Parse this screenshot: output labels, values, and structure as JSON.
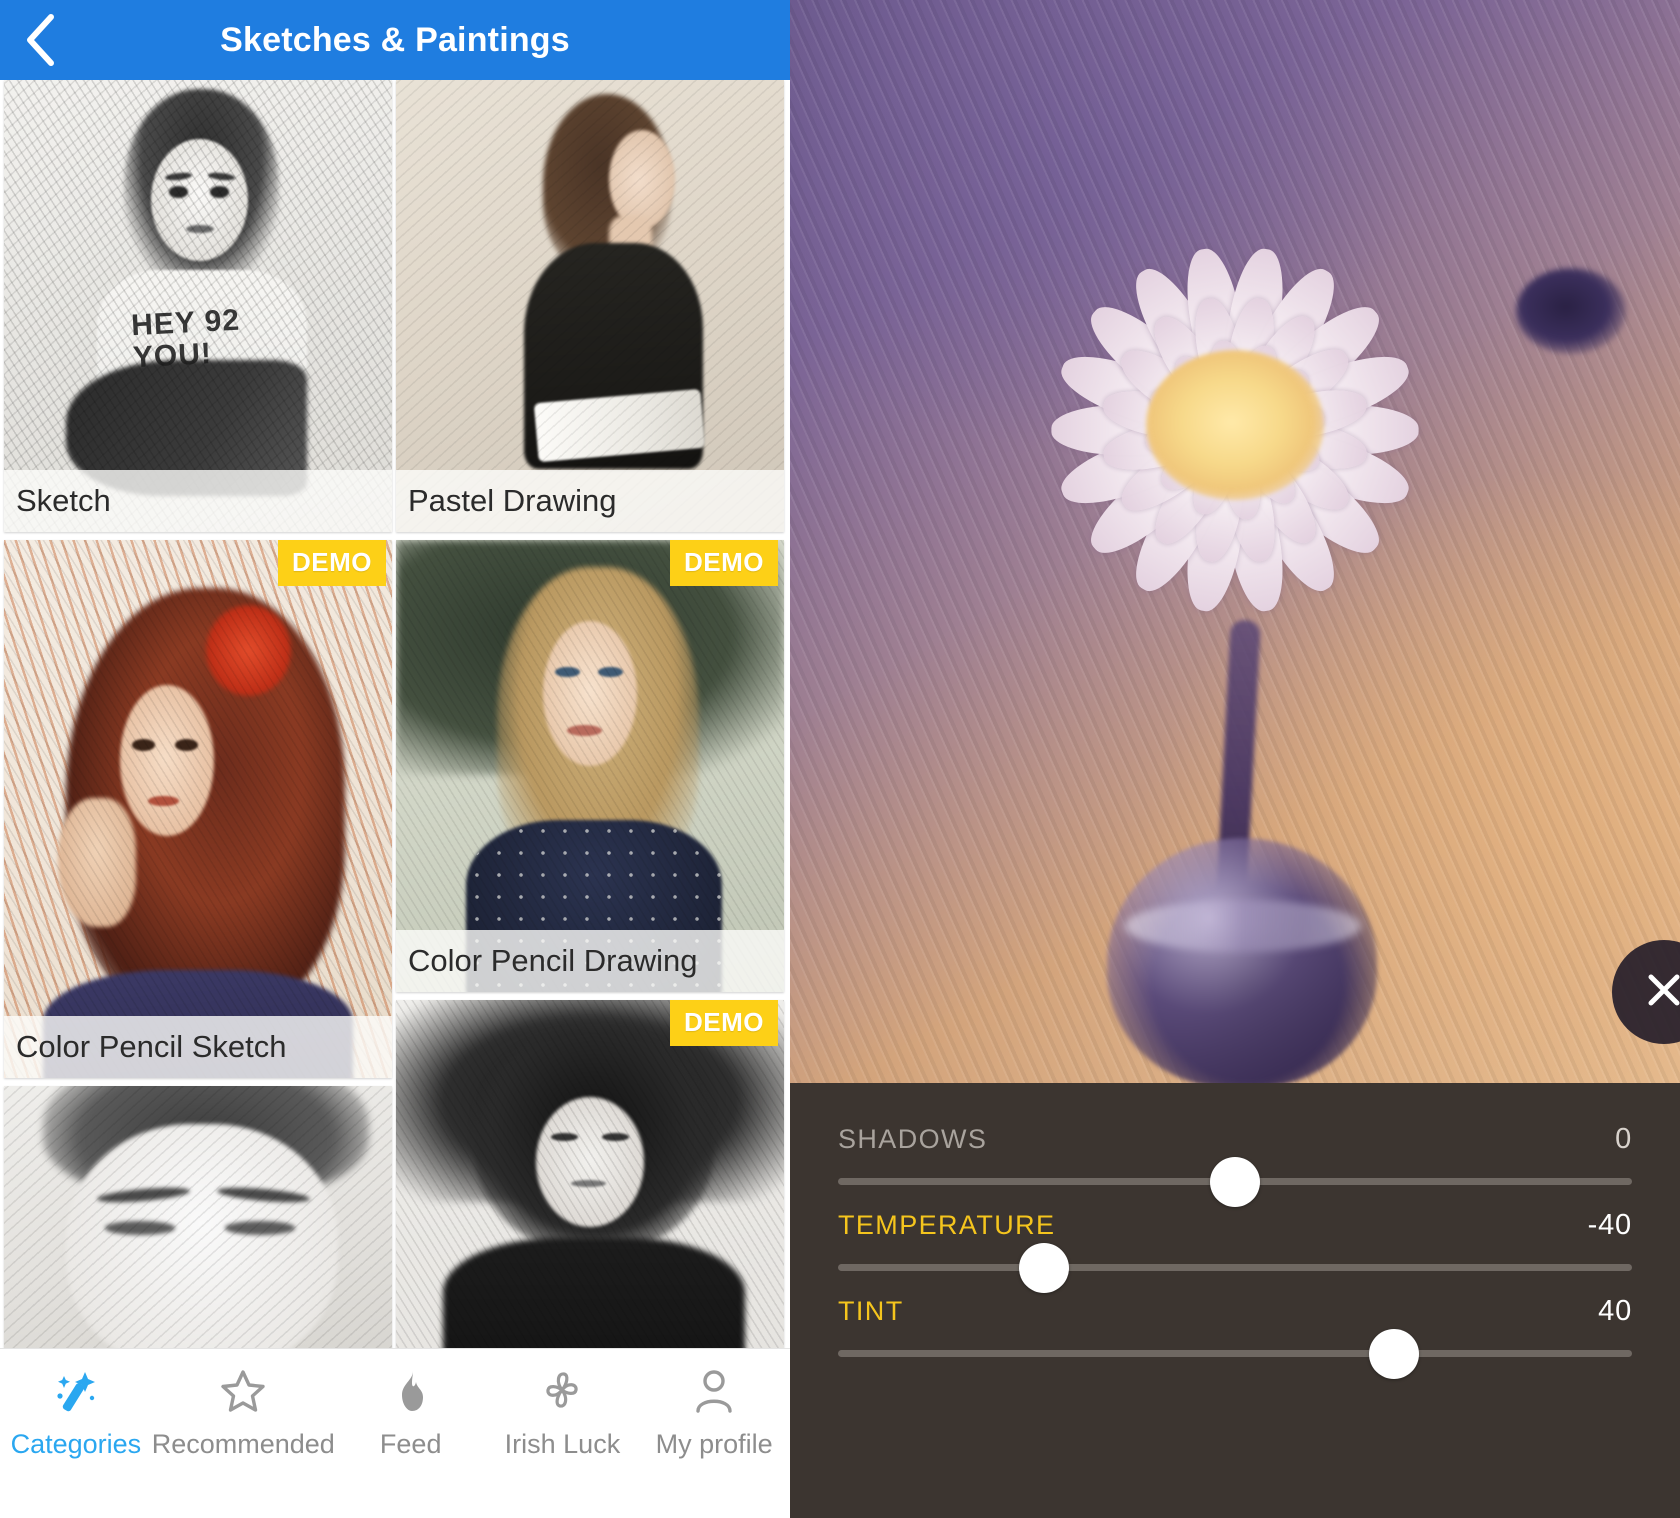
{
  "left_app": {
    "header": {
      "title": "Sketches & Paintings",
      "back_icon": "chevron-left-icon",
      "bar_color": "#1f7de0"
    },
    "effects": [
      {
        "label": "Sketch",
        "demo": false,
        "demo_label": ""
      },
      {
        "label": "Pastel Drawing",
        "demo": false,
        "demo_label": ""
      },
      {
        "label": "Color Pencil Sketch",
        "demo": true,
        "demo_label": "DEMO"
      },
      {
        "label": "Color Pencil Drawing",
        "demo": true,
        "demo_label": "DEMO"
      },
      {
        "label": "",
        "demo": false,
        "demo_label": ""
      },
      {
        "label": "",
        "demo": true,
        "demo_label": "DEMO"
      }
    ],
    "tabbar": {
      "active_color": "#2aa7f0",
      "inactive_color": "#8d8d8d",
      "items": [
        {
          "label": "Categories",
          "icon": "magic-wand-icon",
          "active": true
        },
        {
          "label": "Recommended",
          "icon": "star-icon",
          "active": false
        },
        {
          "label": "Feed",
          "icon": "flame-icon",
          "active": false
        },
        {
          "label": "Irish Luck",
          "icon": "clover-icon",
          "active": false
        },
        {
          "label": "My profile",
          "icon": "person-icon",
          "active": false
        }
      ]
    }
  },
  "right_app": {
    "preview": {
      "subject": "flower-in-vase-photo",
      "cancel_button": {
        "icon": "close-icon",
        "name": "cancel"
      },
      "apply_button": {
        "icon": "check-icon",
        "name": "apply"
      }
    },
    "adjustments": {
      "panel_color": "#3c3530",
      "accent_color": "#f5c51d",
      "sliders": [
        {
          "name": "SHADOWS",
          "value": "0",
          "percent": 50,
          "modified": false
        },
        {
          "name": "TEMPERATURE",
          "value": "-40",
          "percent": 26,
          "modified": true
        },
        {
          "name": "TINT",
          "value": "40",
          "percent": 70,
          "modified": true
        }
      ]
    }
  },
  "art_text": {
    "sketch_tee_line1": "HEY 92",
    "sketch_tee_line2": "YOU!"
  }
}
